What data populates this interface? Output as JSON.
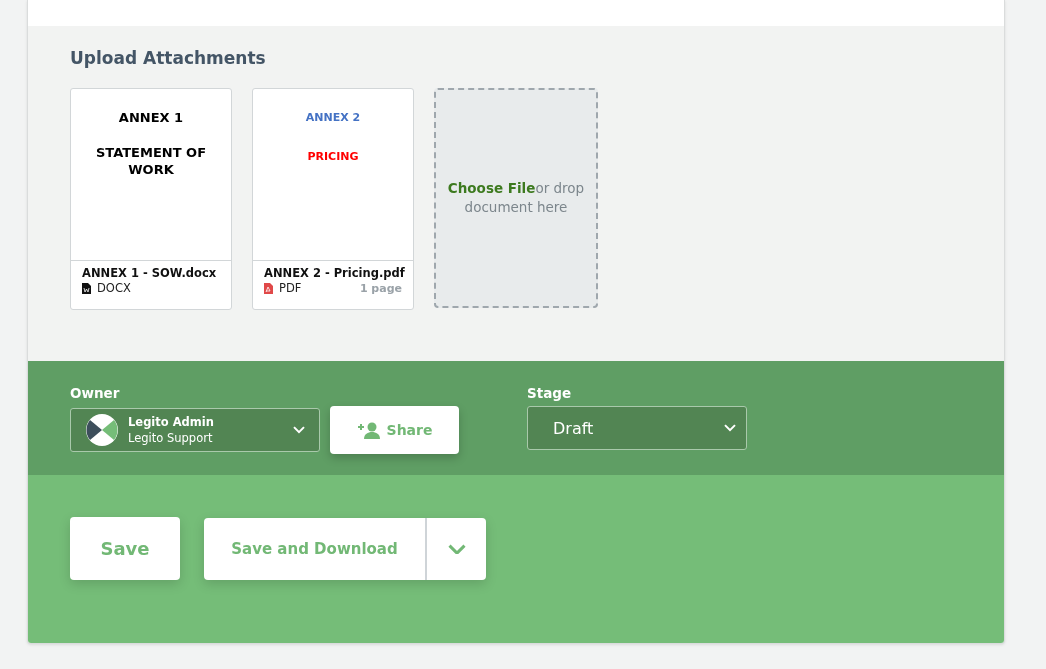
{
  "upload": {
    "title": "Upload Attachments",
    "files": [
      {
        "kind": "docx",
        "preview": [
          {
            "text": "ANNEX 1",
            "color": "#000000"
          },
          {
            "text": "STATEMENT OF WORK",
            "color": "#000000"
          }
        ],
        "name": "ANNEX 1 - SOW.docx",
        "type": "DOCX"
      },
      {
        "kind": "pdf",
        "preview": [
          {
            "text": "ANNEX 2",
            "color": "#4472c4"
          },
          {
            "text": "PRICING",
            "color": "#ff0000"
          }
        ],
        "name": "ANNEX 2 - Pricing.pdf",
        "type": "PDF",
        "pages": "1 page"
      }
    ],
    "dropzone": {
      "link": "Choose File",
      "text": "or drop document here"
    }
  },
  "owner": {
    "label": "Owner",
    "name": "Legito Admin",
    "team": "Legito Support"
  },
  "share": "Share",
  "stage": {
    "label": "Stage",
    "value": "Draft"
  },
  "actions": {
    "save": "Save",
    "save_download": "Save and Download"
  }
}
